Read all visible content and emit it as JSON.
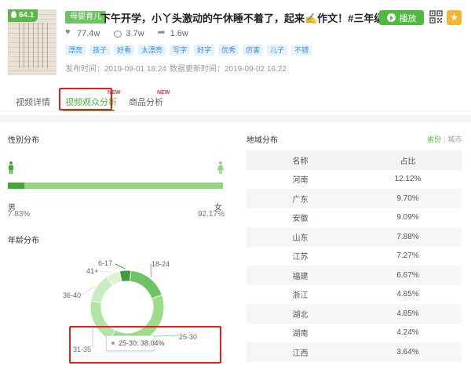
{
  "video": {
    "score": "64.1",
    "category": "母婴育儿",
    "title": "下午开学，小丫头激动的午休睡不着了，起来✍️作文！#三年级",
    "likes": "77.4w",
    "comments": "3.7w",
    "shares": "1.6w",
    "tags": [
      "漂亮",
      "孩子",
      "好看",
      "太漂亮",
      "写字",
      "好字",
      "优秀",
      "厉害",
      "儿子",
      "不错"
    ],
    "publish_time": "发布时间：2019-09-01 18:24",
    "update_time": "数据更新时间：2019-09-02 16:22",
    "play_label": "播放"
  },
  "tabs": {
    "detail": "视频详情",
    "audience": "视频观众分析",
    "goods": "商品分析",
    "new_badge": "NEW"
  },
  "gender": {
    "title": "性别分布",
    "male_label": "男",
    "female_label": "女",
    "male_pct": "7.83%",
    "female_pct": "92.17%",
    "male_fraction": 0.0783
  },
  "age": {
    "title": "年龄分布",
    "tooltip": "25-30: 38.04%",
    "labels": [
      "6-17",
      "18-24",
      "25-30",
      "31-35",
      "36-40",
      "41+"
    ]
  },
  "chart_data": {
    "type": "pie",
    "title": "年龄分布",
    "categories": [
      "6-17",
      "18-24",
      "25-30",
      "31-35",
      "36-40",
      "41+"
    ],
    "values": [
      5,
      18,
      38.04,
      20,
      13,
      6
    ],
    "colors": [
      "#3f9e3a",
      "#6cc35f",
      "#9bdd89",
      "#b3e4a6",
      "#c9ecbe",
      "#dcf3d3"
    ]
  },
  "region": {
    "title": "地域分布",
    "toggle_province": "省份",
    "toggle_city": "城市",
    "col_name": "名称",
    "col_pct": "占比",
    "rows": [
      {
        "name": "河南",
        "pct": "12.12%"
      },
      {
        "name": "广东",
        "pct": "9.70%"
      },
      {
        "name": "安徽",
        "pct": "9.09%"
      },
      {
        "name": "山东",
        "pct": "7.88%"
      },
      {
        "name": "江苏",
        "pct": "7.27%"
      },
      {
        "name": "福建",
        "pct": "6.67%"
      },
      {
        "name": "浙江",
        "pct": "4.85%"
      },
      {
        "name": "湖北",
        "pct": "4.85%"
      },
      {
        "name": "湖南",
        "pct": "4.24%"
      },
      {
        "name": "江西",
        "pct": "3.64%"
      }
    ]
  }
}
